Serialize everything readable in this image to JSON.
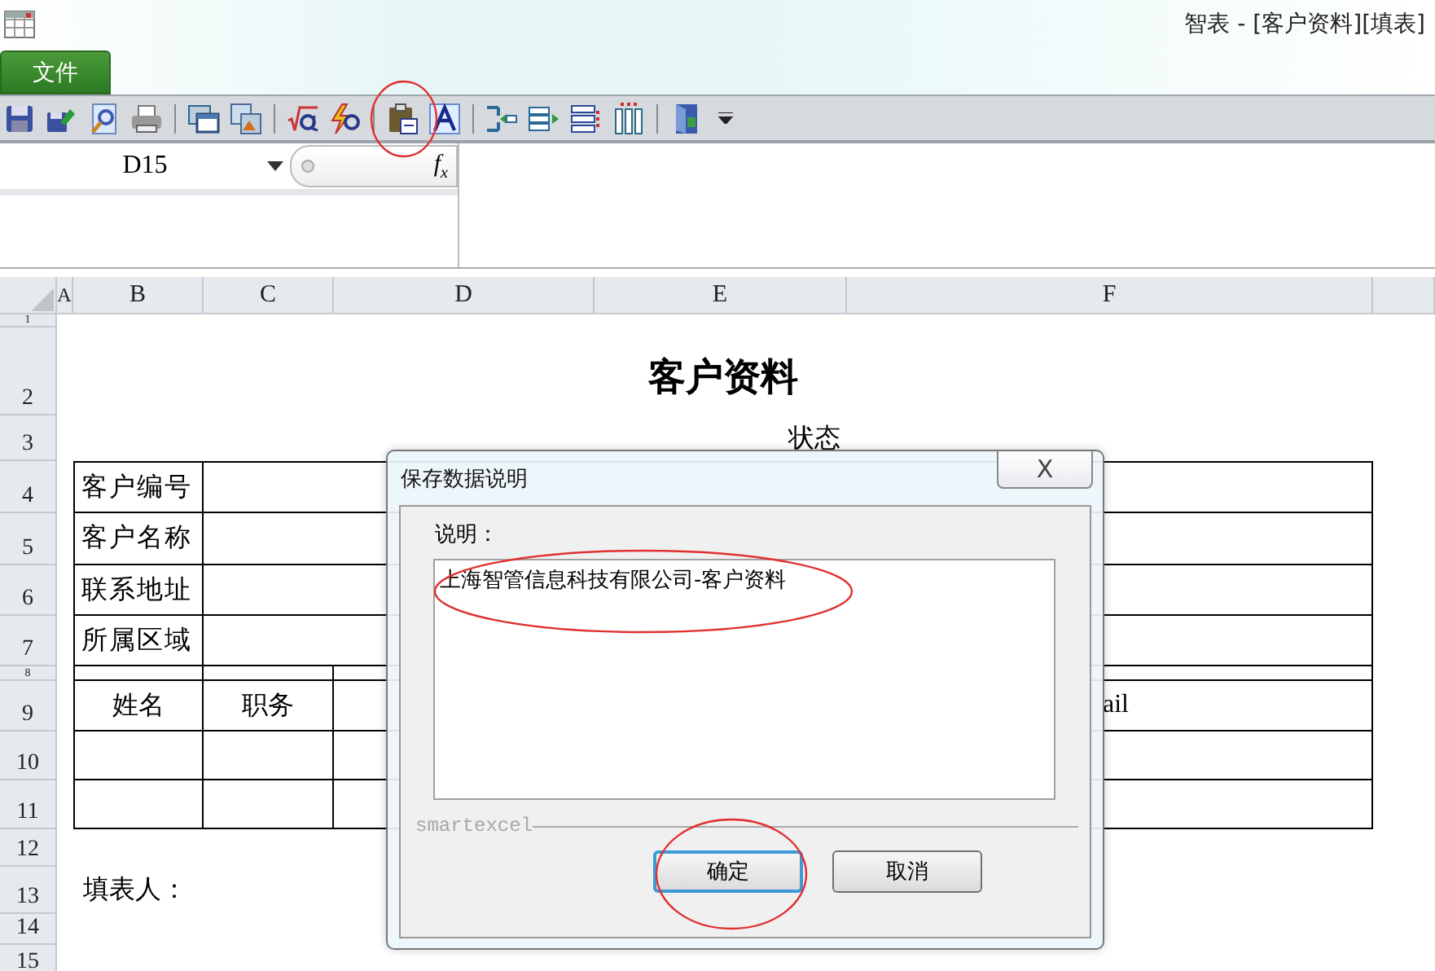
{
  "window": {
    "title": "智表 - [客户资料][填表]"
  },
  "file_tab": {
    "label": "文件"
  },
  "formula_bar": {
    "name_box": "D15",
    "fx_label": "f$_{x}$"
  },
  "sheet": {
    "column_headers": [
      "A",
      "B",
      "C",
      "D",
      "E",
      "F"
    ],
    "row_headers": [
      "1",
      "2",
      "3",
      "4",
      "5",
      "6",
      "7",
      "8",
      "9",
      "10",
      "11",
      "12",
      "13",
      "14",
      "15"
    ],
    "title": "客户资料",
    "status_label": "状态",
    "field_labels": [
      "客户编号",
      "客户名称",
      "联系地址",
      "所属区域"
    ],
    "contact_headers": [
      "姓名",
      "职务",
      "ail"
    ],
    "filler_label": "填表人："
  },
  "dialog": {
    "title": "保存数据说明",
    "close": "X",
    "field_label": "说明：",
    "value": "上海智管信息科技有限公司-客户资料",
    "group_label": "smartexcel",
    "buttons": [
      {
        "label": "确定",
        "default": true
      },
      {
        "label": "取消",
        "default": false
      }
    ]
  }
}
